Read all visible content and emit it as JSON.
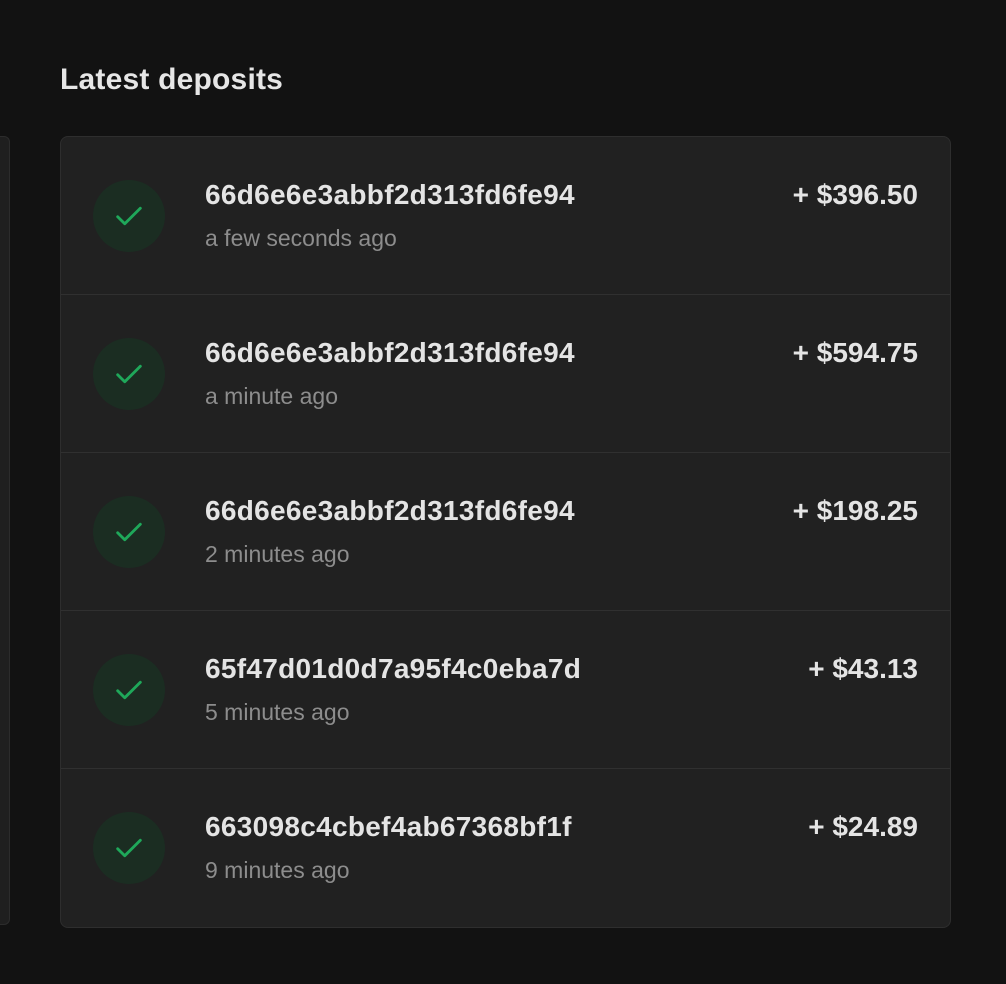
{
  "section": {
    "title": "Latest deposits"
  },
  "colors": {
    "background": "#121212",
    "card": "#212121",
    "check": "#1fa85a",
    "check_bg": "#1b2d22"
  },
  "deposits": [
    {
      "id": "66d6e6e3abbf2d313fd6fe94",
      "time": "a few seconds ago",
      "amount": "+ $396.50",
      "status_icon": "check-icon"
    },
    {
      "id": "66d6e6e3abbf2d313fd6fe94",
      "time": "a minute ago",
      "amount": "+ $594.75",
      "status_icon": "check-icon"
    },
    {
      "id": "66d6e6e3abbf2d313fd6fe94",
      "time": "2 minutes ago",
      "amount": "+ $198.25",
      "status_icon": "check-icon"
    },
    {
      "id": "65f47d01d0d7a95f4c0eba7d",
      "time": "5 minutes ago",
      "amount": "+ $43.13",
      "status_icon": "check-icon"
    },
    {
      "id": "663098c4cbef4ab67368bf1f",
      "time": "9 minutes ago",
      "amount": "+ $24.89",
      "status_icon": "check-icon"
    }
  ]
}
